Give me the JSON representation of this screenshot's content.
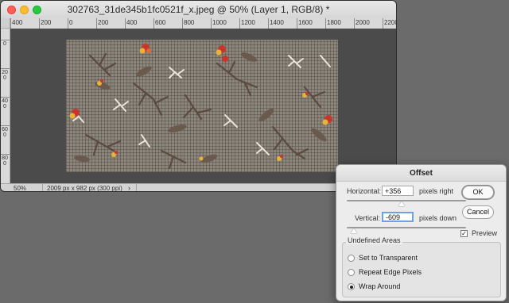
{
  "document": {
    "title": "302763_31de345b1fc0521f_x.jpeg @ 50% (Layer 1, RGB/8) *",
    "ruler_h_labels": [
      "400",
      "200",
      "0",
      "200",
      "400",
      "600",
      "800",
      "1000",
      "1200",
      "1400",
      "1600",
      "1800",
      "2000",
      "2200"
    ],
    "ruler_v_labels": [
      "0",
      "200",
      "400",
      "600",
      "800"
    ],
    "status": {
      "zoom": "50%",
      "info": "2009 px x 982 px (300 ppi)",
      "arrow": "›"
    }
  },
  "dialog": {
    "title": "Offset",
    "horizontal": {
      "label": "Horizontal:",
      "value": "+356",
      "unit": "pixels right"
    },
    "vertical": {
      "label": "Vertical:",
      "value": "-609",
      "unit": "pixels down"
    },
    "ok_label": "OK",
    "cancel_label": "Cancel",
    "preview": {
      "label": "Preview",
      "checked": true,
      "mark": "✓"
    },
    "undefined_areas": {
      "legend": "Undefined Areas",
      "options": [
        "Set to Transparent",
        "Repeat Edge Pixels",
        "Wrap Around"
      ],
      "selected": "Wrap Around"
    }
  },
  "colors": {
    "fabric": "#8c857b",
    "flower_red": "#c8352b",
    "flower_yellow": "#e8b33a",
    "branch": "#5a4a40",
    "leaf_white": "#e9e4d8"
  }
}
